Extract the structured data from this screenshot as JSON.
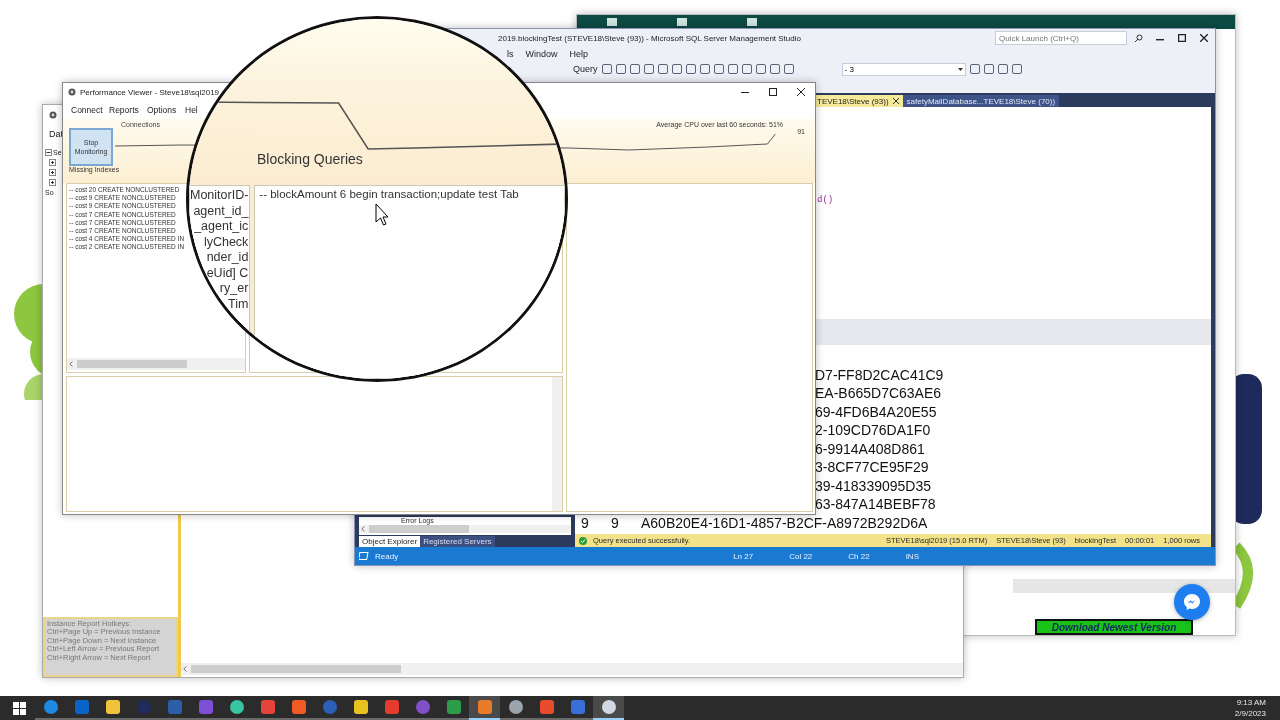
{
  "browser_page": {
    "download_button": "Download Newest Version"
  },
  "back_window": {
    "menu": [
      "Dat"
    ],
    "tree": [
      {
        "label": "Se",
        "expanded": true,
        "children": [
          {
            "expanded": false
          },
          {
            "expanded": false
          },
          {
            "expanded": false
          }
        ]
      },
      {
        "label": "So"
      }
    ],
    "hotkeys": [
      "Instance Report Hotkeys:",
      "Ctrl+Page Up = Previous Instance",
      "Ctrl+Page Down = Next Instance",
      "Ctrl+Left Arrow = Previous Report",
      "Ctrl+Right Arrow = Next Report"
    ]
  },
  "ssms": {
    "title": "2019.blockingTest (STEVE18\\Steve (93)) - Microsoft SQL Server Management Studio",
    "quick_launch": {
      "placeholder": "Quick Launch (Ctrl+Q)"
    },
    "menu": [
      "ls",
      "Window",
      "Help"
    ],
    "toolbar": {
      "query_label": "Query",
      "combo_value": "- 3"
    },
    "tabs": [
      {
        "label": "TEVE18\\Steve (93))",
        "selected": true
      },
      {
        "label": "safetyMailDatabase...TEVE18\\Steve (70))",
        "selected": false
      }
    ],
    "editor_fragment": "d()",
    "results": [
      {
        "kind": "partial",
        "text": "D7-FF8D2CAC41C9"
      },
      {
        "kind": "partial",
        "text": "EA-B665D7C63AE6"
      },
      {
        "kind": "partial",
        "text": "69-4FD6B4A20E55"
      },
      {
        "kind": "partial",
        "text": "2-109CD76DA1F0"
      },
      {
        "kind": "partial",
        "text": "6-9914A408D861"
      },
      {
        "kind": "partial",
        "text": "3-8CF77CE95F29"
      },
      {
        "kind": "partial",
        "text": "39-418339095D35"
      },
      {
        "kind": "partial",
        "text": "63-847A14BEBF78"
      },
      {
        "kind": "full",
        "cells": [
          "9",
          "9",
          "A60B20E4-16D1-4857-B2CF-A8972B292D6A"
        ]
      }
    ],
    "query_status": {
      "message": "Query executed successfully.",
      "items": [
        "STEVE18\\sql2019 (15.0 RTM)",
        "STEVE18\\Steve (93)",
        "blockingTest",
        "00:00:01",
        "1,000 rows"
      ]
    },
    "explorer": {
      "node": "Error Logs",
      "tabs": [
        {
          "label": "Object Explorer",
          "selected": true
        },
        {
          "label": "Registered Servers",
          "selected": false
        }
      ]
    },
    "status_bar": {
      "state": "Ready",
      "items": [
        "Ln 27",
        "Col 22",
        "Ch 22",
        "INS"
      ]
    }
  },
  "perf_viewer": {
    "title": "Performance Viewer - Steve18\\sql2019",
    "menu": [
      "Connect",
      "Reports",
      "Options",
      "Hel"
    ],
    "connections_label": "Connections",
    "stop_button": "Stop Monitoring",
    "cpu_caption": "Average CPU over last 60 seconds: 51%",
    "cpu_peak": "91",
    "missing_indexes_label": "Missing Indexes",
    "missing_indexes": [
      "-- cost 20  CREATE NONCLUSTERED",
      "-- cost 9  CREATE NONCLUSTERED",
      "-- cost 9  CREATE NONCLUSTERED",
      "-- cost 7  CREATE NONCLUSTERED",
      "-- cost 7  CREATE NONCLUSTERED",
      "-- cost 7  CREATE NONCLUSTERED",
      "-- cost 4  CREATE NONCLUSTERED IN",
      "-- cost 2  CREATE NONCLUSTERED IN"
    ]
  },
  "magnifier": {
    "heading": "Blocking Queries",
    "left_fragments": [
      "MonitorID-",
      "agent_id_",
      "_agent_ic",
      "lyCheck",
      "nder_id",
      "eUid] C",
      "ry_er",
      "Tim"
    ],
    "query_line": "-- blockAmount 6   begin transaction;update test Tab"
  },
  "taskbar": {
    "apps": [
      {
        "color": "#1e88e5",
        "active": false
      },
      {
        "color": "#0a64c8",
        "active": false
      },
      {
        "color": "#f2c23a",
        "active": false
      },
      {
        "color": "#1f2b5a",
        "active": false
      },
      {
        "color": "#2d5fa8",
        "active": false
      },
      {
        "color": "#7b4fd6",
        "active": false
      },
      {
        "color": "#36c5a0",
        "active": false
      },
      {
        "color": "#e5443a",
        "active": false
      },
      {
        "color": "#f05a24",
        "active": false
      },
      {
        "color": "#2b5fb8",
        "active": false
      },
      {
        "color": "#e8c020",
        "active": false
      },
      {
        "color": "#e53b2c",
        "active": false
      },
      {
        "color": "#8050c8",
        "active": false
      },
      {
        "color": "#2e9d4a",
        "active": false
      },
      {
        "color": "#e87a2a",
        "active": true
      },
      {
        "color": "#9aa4ad",
        "active": false
      },
      {
        "color": "#e84c2c",
        "active": false
      },
      {
        "color": "#3a6fd8",
        "active": false
      },
      {
        "color": "#cfd8e3",
        "active": true
      }
    ],
    "clock": {
      "time": "9:13 AM",
      "date": "2/9/2023"
    }
  }
}
